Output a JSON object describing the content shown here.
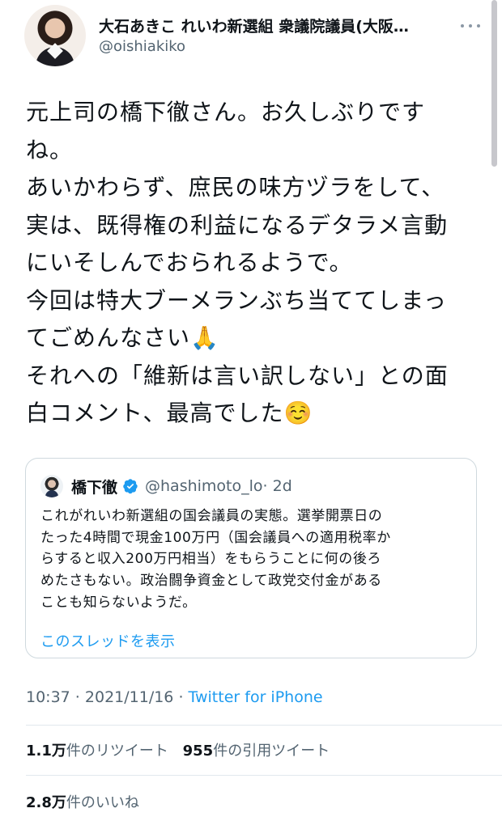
{
  "author": {
    "display_name": "大石あきこ れいわ新選組 衆議院議員(大阪…",
    "handle": "@oishiakiko"
  },
  "menu_icon": "more-horizontal-icon",
  "tweet": {
    "lines": [
      "元上司の橋下徹さん。お久しぶりです",
      "ね。",
      "あいかわらず、庶民の味方ヅラをして、",
      "実は、既得権の利益になるデタラメ言動",
      "にいそしんでおられるようで。",
      "今回は特大ブーメランぶち当ててしまっ",
      "てごめんなさい🙏",
      "それへの「維新は言い訳しない」との面",
      "白コメント、最高でした☺️"
    ]
  },
  "quoted": {
    "name": "橋下徹",
    "verified": true,
    "handle": "@hashimoto_lo",
    "time": "· 2d",
    "lines": [
      "これがれいわ新選組の国会議員の実態。選挙開票日の",
      "たった4時間で現金100万円（国会議員への適用税率か",
      "らすると収入200万円相当）をもらうことに何の後ろ",
      "めたさもない。政治闘争資金として政党交付金がある",
      "ことも知らないようだ。"
    ],
    "thread_link": "このスレッドを表示"
  },
  "meta": {
    "time": "10:37",
    "sep1": " · ",
    "date": "2021/11/16",
    "sep2": " · ",
    "source": "Twitter for iPhone"
  },
  "stats": {
    "retweets_count": "1.1万",
    "retweets_label": "件のリツイート",
    "quotes_count": "955",
    "quotes_label": "件の引用ツイート",
    "likes_count": "2.8万",
    "likes_label": "件のいいね"
  },
  "colors": {
    "link": "#1d9bf0",
    "secondary": "#536471",
    "border": "#cfd9de"
  }
}
